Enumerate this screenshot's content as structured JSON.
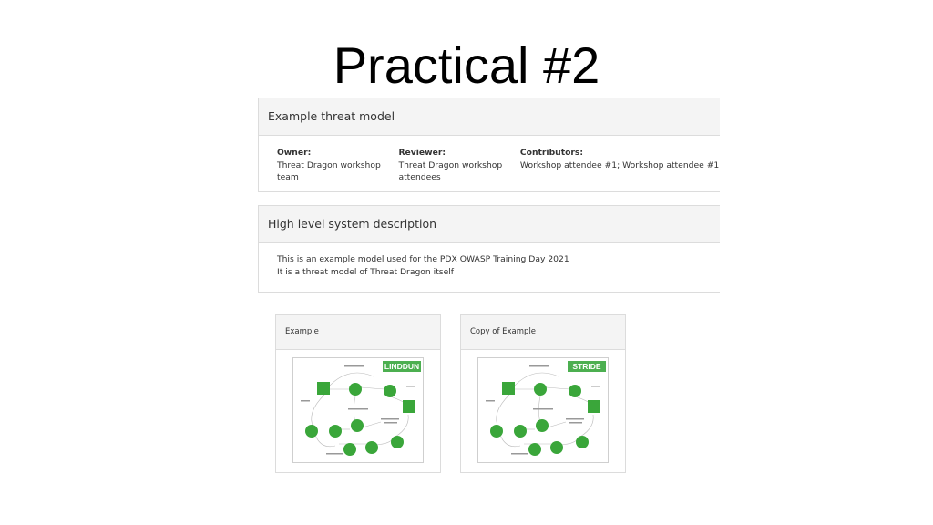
{
  "slide": {
    "title": "Practical #2"
  },
  "threat_model": {
    "header": "Example threat model",
    "owner_label": "Owner:",
    "owner_line1": "Threat Dragon workshop",
    "owner_line2": "team",
    "reviewer_label": "Reviewer:",
    "reviewer_line1": "Threat Dragon workshop",
    "reviewer_line2": "attendees",
    "contributors_label": "Contributors:",
    "contributors_value": "Workshop attendee #1; Workshop attendee #1"
  },
  "system_description": {
    "header": "High level system description",
    "line1": "This is an example model used for the PDX OWASP Training Day 2021",
    "line2": "It is a threat model of Threat Dragon itself"
  },
  "diagrams": [
    {
      "title": "Example",
      "badge": "LINDDUN"
    },
    {
      "title": "Copy of Example",
      "badge": "STRIDE"
    }
  ],
  "colors": {
    "diagram_green": "#3aa63a",
    "badge_green": "#4caf50"
  }
}
